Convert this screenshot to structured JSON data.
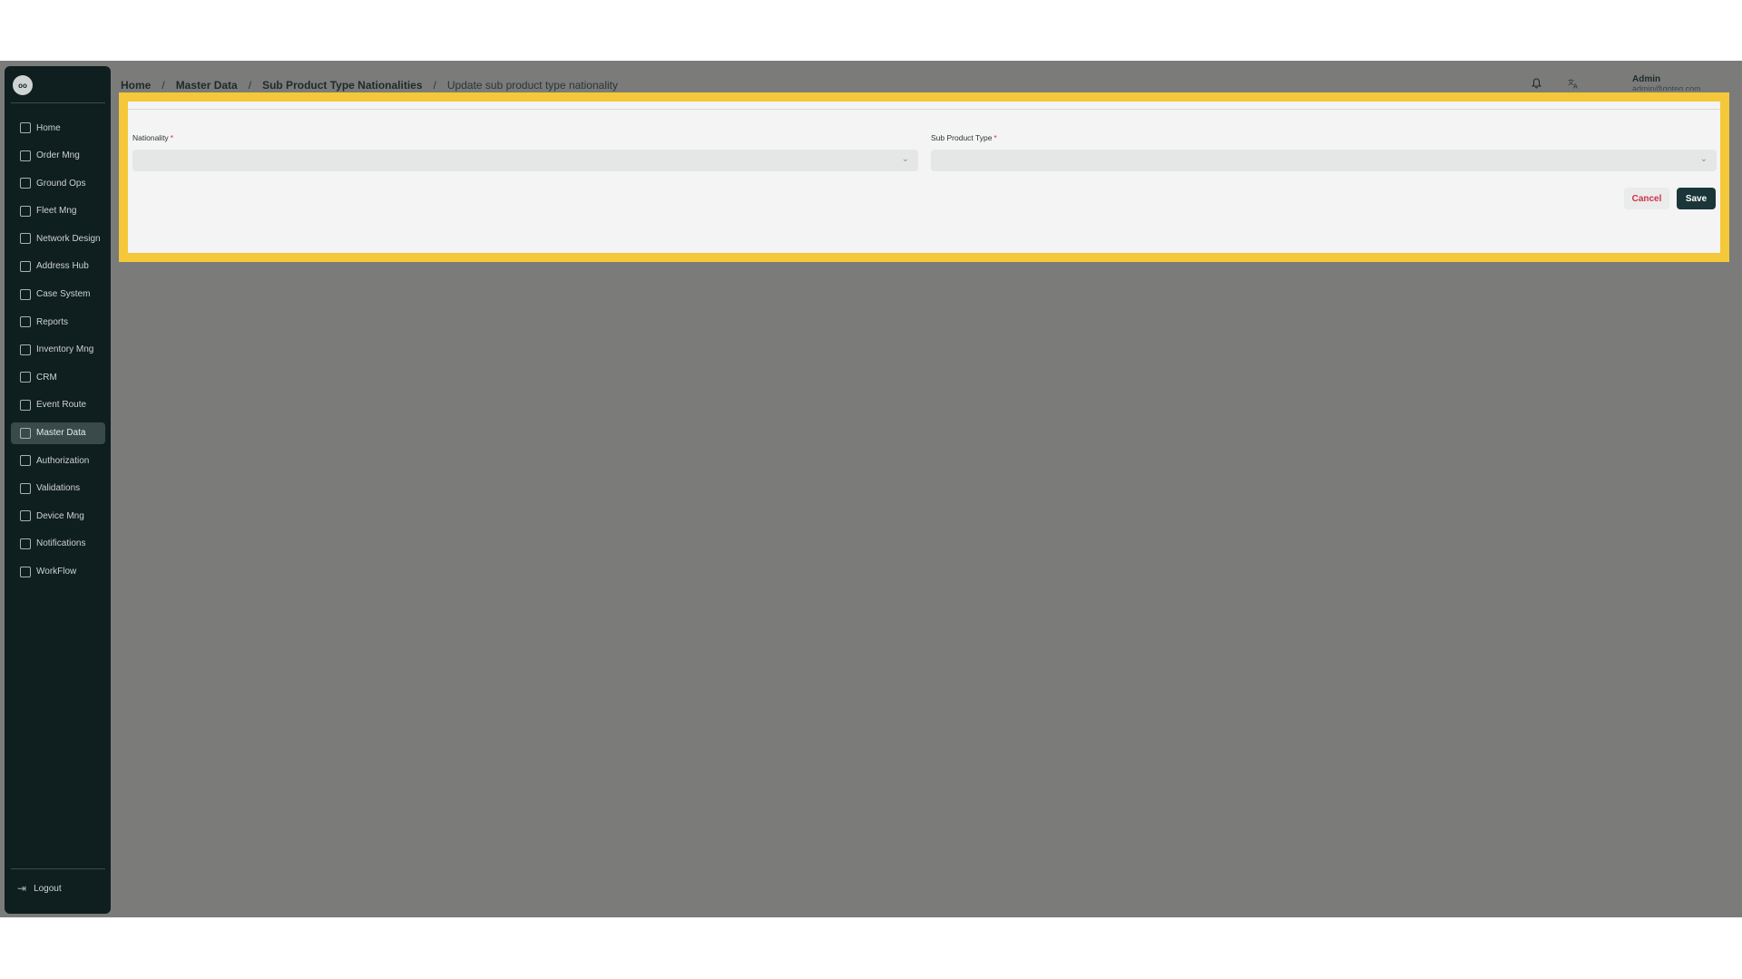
{
  "sidebar": {
    "logo_text": "oo",
    "items": [
      {
        "label": "Home",
        "icon": "home-icon"
      },
      {
        "label": "Order Mng",
        "icon": "order-icon"
      },
      {
        "label": "Ground Ops",
        "icon": "ground-ops-icon"
      },
      {
        "label": "Fleet Mng",
        "icon": "truck-icon"
      },
      {
        "label": "Network Design",
        "icon": "network-icon"
      },
      {
        "label": "Address Hub",
        "icon": "address-icon"
      },
      {
        "label": "Case System",
        "icon": "case-icon"
      },
      {
        "label": "Reports",
        "icon": "reports-icon"
      },
      {
        "label": "Inventory Mng",
        "icon": "inventory-icon"
      },
      {
        "label": "CRM",
        "icon": "crm-icon"
      },
      {
        "label": "Event Route",
        "icon": "route-icon"
      },
      {
        "label": "Master Data",
        "icon": "database-icon",
        "active": true
      },
      {
        "label": "Authorization",
        "icon": "users-icon"
      },
      {
        "label": "Validations",
        "icon": "validations-icon"
      },
      {
        "label": "Device Mng",
        "icon": "device-icon"
      },
      {
        "label": "Notifications",
        "icon": "bell-icon"
      },
      {
        "label": "WorkFlow",
        "icon": "workflow-icon"
      }
    ],
    "logout_label": "Logout"
  },
  "breadcrumb": {
    "home": "Home",
    "master_data": "Master Data",
    "section": "Sub Product Type Nationalities",
    "current": "Update sub product type nationality",
    "separator": "/"
  },
  "header": {
    "user_name": "Admin",
    "user_email": "admin@goteq.com"
  },
  "form": {
    "nationality_label": "Nationality",
    "sub_product_type_label": "Sub Product Type",
    "required_mark": "*",
    "nationality_value": "",
    "sub_product_type_value": "",
    "cancel_label": "Cancel",
    "save_label": "Save"
  },
  "colors": {
    "highlight": "#f5c83a",
    "sidebar_bg": "#0f1e1f",
    "overlay_bg": "#7b7c7a",
    "save_bg": "#1b3638",
    "cancel_text": "#d0304c"
  }
}
